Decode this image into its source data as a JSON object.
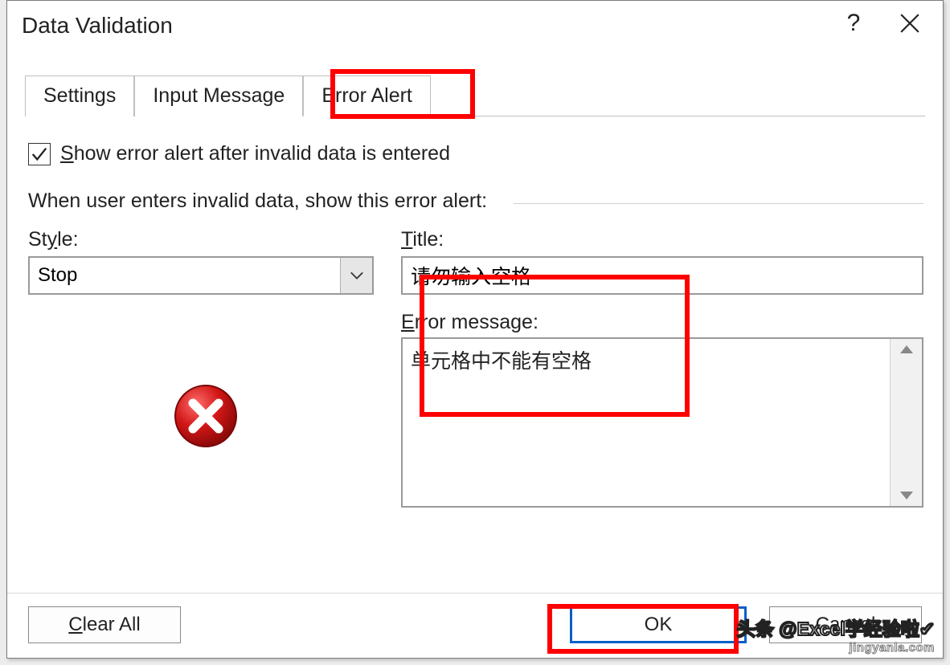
{
  "dialog": {
    "title": "Data Validation",
    "help_tooltip": "?"
  },
  "tabs": {
    "settings": "Settings",
    "input_message": "Input Message",
    "error_alert": "Error Alert"
  },
  "content": {
    "show_alert_checkbox_label_pre": "S",
    "show_alert_checkbox_label_post": "how error alert after invalid data is entered",
    "section_heading": "When user enters invalid data, show this error alert:",
    "style_label_pre": "St",
    "style_label_u": "y",
    "style_label_post": "le:",
    "style_value": "Stop",
    "title_label_u": "T",
    "title_label_post": "itle:",
    "title_value": "请勿输入空格",
    "error_msg_label_u": "E",
    "error_msg_label_post": "rror message:",
    "error_msg_value": "单元格中不能有空格"
  },
  "footer": {
    "clear_all_u": "C",
    "clear_all_post": "lear All",
    "ok": "OK",
    "cancel": "Cancel"
  },
  "watermark": {
    "line1": "头条 @Excel学经验啦✔",
    "line2": "jingyanla.com"
  }
}
